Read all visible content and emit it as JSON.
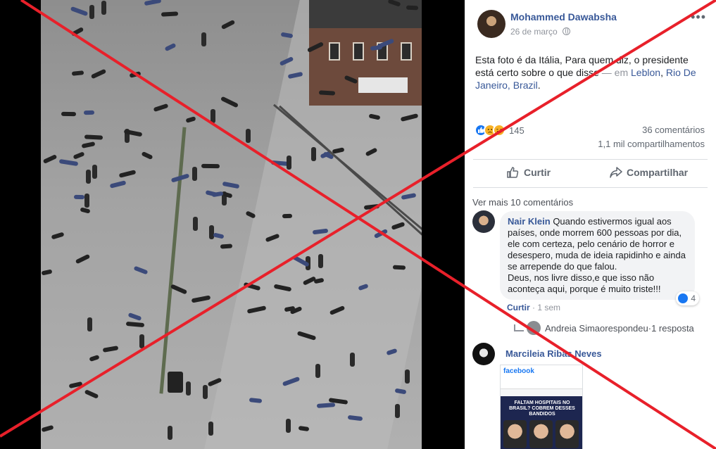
{
  "post": {
    "author": "Mohammed Dawabsha",
    "date": "26 de março",
    "more": "•••",
    "text": "Esta foto é da Itália, Para quem diz, o presidente está certo sobre o que disse",
    "location_prefix": " — em ",
    "location_1": "Leblon",
    "location_sep": ", ",
    "location_2": "Rio De Janeiro, Brazil",
    "location_end": ".",
    "reaction_count": "145",
    "comments_count": "36 comentários",
    "shares_count": "1,1 mil compartilhamentos"
  },
  "actions": {
    "like_label": "Curtir",
    "share_label": "Compartilhar"
  },
  "comments": {
    "more_label": "Ver mais 10 comentários",
    "c1": {
      "author": "Nair Klein",
      "text": "Quando estivermos igual aos países, onde morrem 600 pessoas por dia, ele com certeza, pelo cenário de horror e desespero, muda de ideia rapidinho e ainda se arrepende do que falou.\nDeus, nos livre disso,e que isso não aconteça aqui, porque é muito triste!!!",
      "reactions": "4",
      "like_label": "Curtir",
      "sep": " · ",
      "time": "1 sem"
    },
    "reply": {
      "name": "Andreia Simao",
      "text": " respondeu",
      "sep": " · ",
      "count": "1 resposta"
    },
    "c2": {
      "author": "Marcileia Ribas Neves",
      "image_brand": "facebook",
      "image_headline": "FALTAM HOSPITAIS NO BRASIL? COBREM DESSES BANDIDOS"
    }
  },
  "colors": {
    "cross": "#e8202a",
    "link": "#385898",
    "like": "#1877f2"
  }
}
